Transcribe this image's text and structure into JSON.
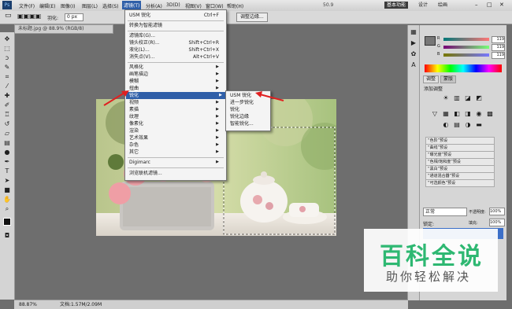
{
  "menubar": {
    "app_icon": "Ps",
    "items": [
      "文件(F)",
      "编辑(E)",
      "图像(I)",
      "图层(L)",
      "选择(S)",
      "滤镜(T)",
      "分析(A)",
      "3D(D)",
      "视图(V)",
      "窗口(W)",
      "帮助(H)"
    ],
    "zoom": "50.9",
    "workspace_buttons": [
      "基本功能",
      "设计",
      "绘画"
    ]
  },
  "options": {
    "feather_label": "羽化:",
    "feather_value": "0 px",
    "refine_edge_button": "调整边缘..."
  },
  "document": {
    "tab_title": "未标题.jpg @ 88.9% (RGB/8)",
    "zoom_readout": "88.87%",
    "doc_size": "文档:1.57M/2.09M"
  },
  "filter_menu": {
    "items": [
      {
        "label": "USM 锐化",
        "shortcut": "Ctrl+F"
      },
      {
        "label": "转换为智能滤镜",
        "shortcut": ""
      },
      {
        "label": "滤镜库(G)...",
        "shortcut": ""
      },
      {
        "label": "镜头校正(R)...",
        "shortcut": "Shift+Ctrl+R"
      },
      {
        "label": "液化(L)...",
        "shortcut": "Shift+Ctrl+X"
      },
      {
        "label": "消失点(V)...",
        "shortcut": "Alt+Ctrl+V"
      },
      {
        "label": "风格化",
        "shortcut": ""
      },
      {
        "label": "画笔描边",
        "shortcut": ""
      },
      {
        "label": "模糊",
        "shortcut": ""
      },
      {
        "label": "扭曲",
        "shortcut": ""
      },
      {
        "label": "锐化",
        "shortcut": ""
      },
      {
        "label": "视频",
        "shortcut": ""
      },
      {
        "label": "素描",
        "shortcut": ""
      },
      {
        "label": "纹理",
        "shortcut": ""
      },
      {
        "label": "像素化",
        "shortcut": ""
      },
      {
        "label": "渲染",
        "shortcut": ""
      },
      {
        "label": "艺术效果",
        "shortcut": ""
      },
      {
        "label": "杂色",
        "shortcut": ""
      },
      {
        "label": "其它",
        "shortcut": ""
      },
      {
        "label": "Digimarc",
        "shortcut": ""
      },
      {
        "label": "浏览联机滤镜...",
        "shortcut": ""
      }
    ],
    "submenu_arrow": "▶"
  },
  "sharpen_submenu": {
    "items": [
      "USM 锐化",
      "进一步锐化",
      "锐化",
      "锐化边缘",
      "智能锐化..."
    ]
  },
  "color_panel": {
    "values": [
      "119",
      "119",
      "119"
    ],
    "channels": [
      "R",
      "G",
      "B"
    ]
  },
  "adjust_panel": {
    "tabs": [
      "调整",
      "蒙版"
    ],
    "add_label": "添加调整",
    "presets": [
      "“色阶”预设",
      "“曲线”预设",
      "“曝光度”预设",
      "“色相/饱和度”预设",
      "“黑白”预设",
      "“通道混合器”预设",
      "“可选颜色”预设"
    ]
  },
  "layers_panel": {
    "blend_mode": "正常",
    "opacity_label": "不透明度:",
    "opacity_value": "100%",
    "lock_label": "锁定:",
    "fill_label": "填充:",
    "fill_value": "100%"
  },
  "watermark": {
    "title": "百科全说",
    "subtitle": "助你轻松解决"
  }
}
